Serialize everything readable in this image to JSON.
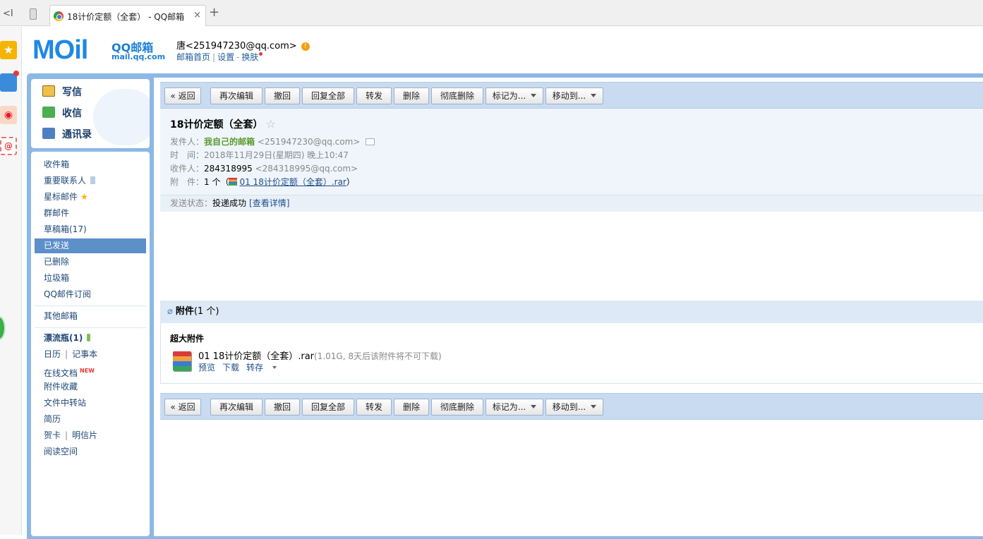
{
  "browser": {
    "back": "<I",
    "tab_title": "18计价定额（全套） - QQ邮箱",
    "tab_close": "×",
    "new_tab": "+"
  },
  "header": {
    "logo_text": "MOil",
    "logo_brand": "QQ邮箱",
    "logo_url": "mail.qq.com",
    "user": "唐<251947230@qq.com>",
    "links": [
      "邮箱首页",
      "设置",
      "换肤"
    ]
  },
  "nav": {
    "write": "写信",
    "receive": "收信",
    "contacts": "通讯录",
    "folders": [
      "收件箱",
      "重要联系人",
      "星标邮件",
      "群邮件",
      "草稿箱(17)",
      "已发送",
      "已删除",
      "垃圾箱",
      "QQ邮件订阅"
    ],
    "other": "其他邮箱",
    "bottle": "漂流瓶(1)",
    "calendar": "日历",
    "notes": "记事本",
    "docs": "在线文档",
    "docs_badge": "NEW",
    "att_collect": "附件收藏",
    "transfer": "文件中转站",
    "resume": "简历",
    "card": "贺卡",
    "postcard": "明信片",
    "reading": "阅读空间"
  },
  "toolbar": {
    "back": "« 返回",
    "reedit": "再次编辑",
    "recall": "撤回",
    "reply_all": "回复全部",
    "forward": "转发",
    "delete": "删除",
    "delete_perm": "彻底删除",
    "mark": "标记为...",
    "move": "移动到..."
  },
  "mail": {
    "subject": "18计价定额（全套）",
    "star": "☆",
    "from_label": "发件人：",
    "from_name": "我自己的邮箱",
    "from_addr": "<251947230@qq.com>",
    "time_label": "时　间：",
    "time": "2018年11月29日(星期四) 晚上10:47",
    "to_label": "收件人：",
    "to_name": "284318995",
    "to_addr": "<284318995@qq.com>",
    "att_label": "附　件：",
    "att_count": "1 个（",
    "att_file": "01 18计价定额（全套）.rar",
    "att_close": "）",
    "status_label": "发送状态：",
    "status": "投递成功",
    "status_link": "[查看详情]"
  },
  "attachments": {
    "title": "附件",
    "count": "(1 个)",
    "section": "超大附件",
    "file": "01 18计价定额（全套）.rar",
    "info": "(1.01G, 8天后该附件将不可下载)",
    "preview": "预览",
    "download": "下载",
    "save": "转存"
  }
}
